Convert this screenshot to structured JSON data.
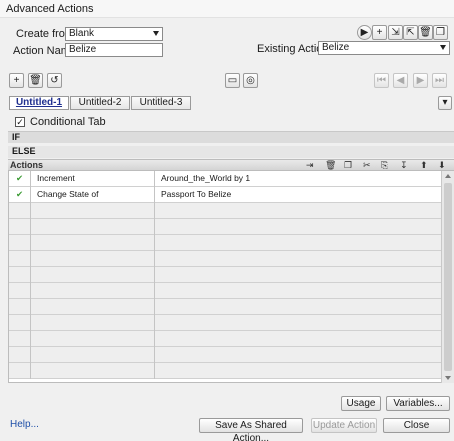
{
  "window": {
    "title": "Advanced Actions"
  },
  "form": {
    "create_from_label": "Create from:",
    "create_from_value": "Blank",
    "action_name_label": "Action Name:",
    "action_name_value": "Belize",
    "existing_actions_label": "Existing Actions:",
    "existing_actions_value": "Belize"
  },
  "tabs": [
    {
      "label": "Untitled-1",
      "active": true
    },
    {
      "label": "Untitled-2",
      "active": false
    },
    {
      "label": "Untitled-3",
      "active": false
    }
  ],
  "conditional": {
    "label": "Conditional Tab",
    "checked": true
  },
  "sections": {
    "if_label": "IF",
    "else_label": "ELSE",
    "actions_label": "Actions"
  },
  "rows": [
    {
      "status": "✔",
      "action": "Increment",
      "params": "Around_the_World   by   1"
    },
    {
      "status": "✔",
      "action": "Change State of",
      "params": "Passport   To   Belize"
    }
  ],
  "icons": {
    "play": "play-icon",
    "add": "add-icon",
    "import": "import-icon",
    "export": "export-icon",
    "delete": "trash-icon",
    "duplicate": "duplicate-icon",
    "reset": "reset-icon",
    "save_template": "save-template-icon",
    "preview": "preview-icon",
    "first": "first-icon",
    "prev": "prev-icon",
    "next": "next-icon",
    "last": "last-icon"
  },
  "buttons": {
    "usage": "Usage",
    "variables": "Variables...",
    "help": "Help...",
    "save_shared": "Save As Shared Action...",
    "update": "Update Action",
    "close": "Close"
  },
  "colors": {
    "check": "#3a9a32",
    "link": "#1e4fa8",
    "active_tab": "#1f2f8f"
  }
}
